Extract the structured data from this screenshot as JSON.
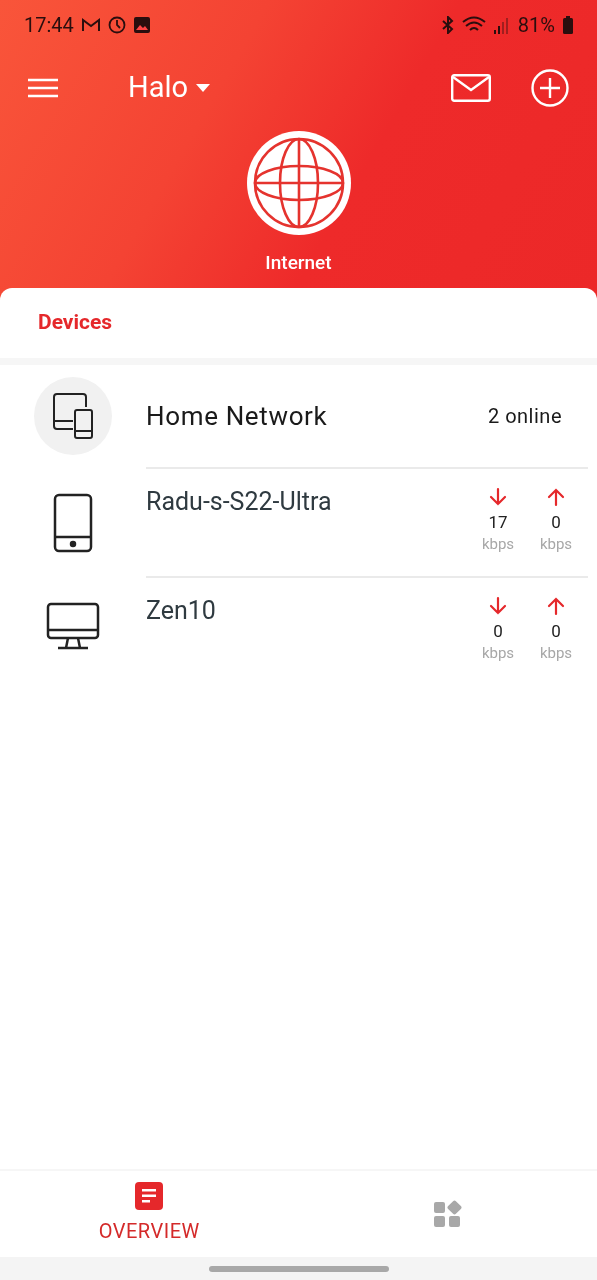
{
  "status_bar": {
    "time": "17:44",
    "battery": "81%"
  },
  "header": {
    "title": "Halo"
  },
  "internet": {
    "label": "Internet"
  },
  "section": {
    "title": "Devices"
  },
  "home_network": {
    "name": "Home Network",
    "count": "2 online"
  },
  "devices": [
    {
      "name": "Radu-s-S22-Ultra",
      "kind": "phone",
      "down": "17",
      "down_unit": "kbps",
      "up": "0",
      "up_unit": "kbps"
    },
    {
      "name": "Zen10",
      "kind": "desktop",
      "down": "0",
      "down_unit": "kbps",
      "up": "0",
      "up_unit": "kbps"
    }
  ],
  "nav": [
    {
      "kind": "overview",
      "label": "OVERVIEW",
      "selected": true
    },
    {
      "kind": "apps",
      "selected": false
    }
  ]
}
